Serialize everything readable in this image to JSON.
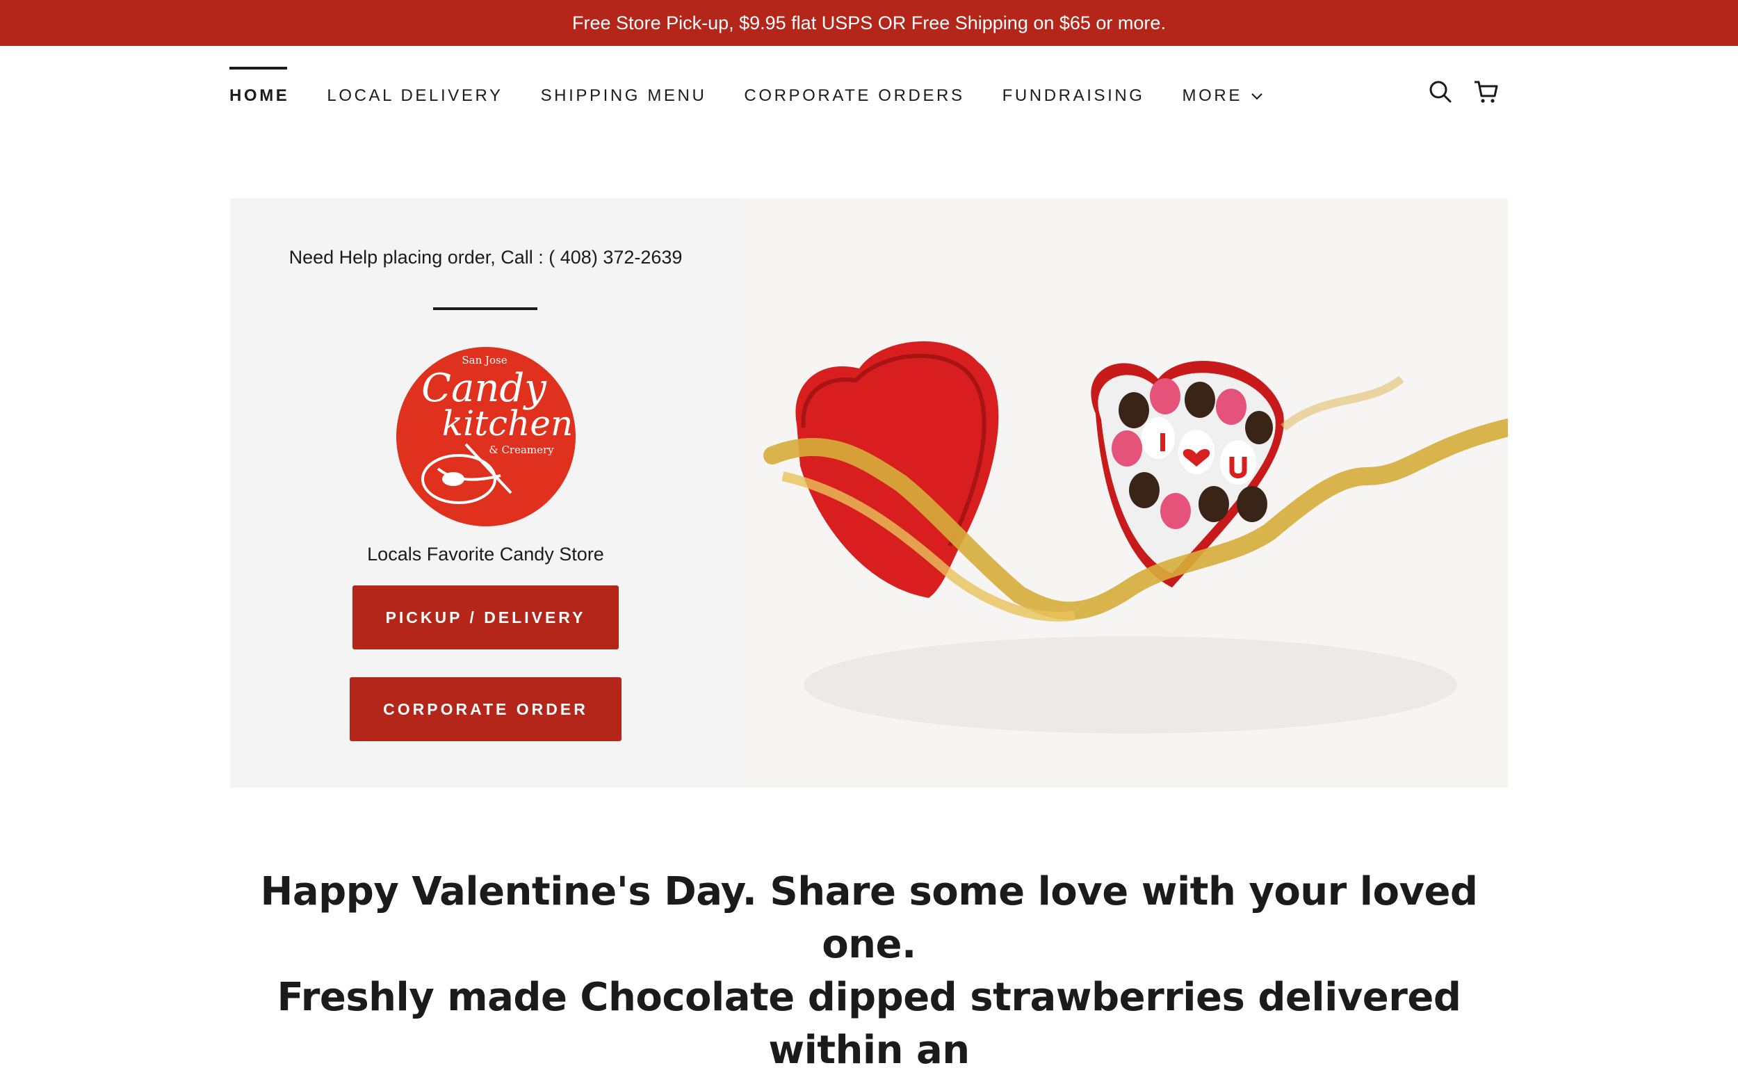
{
  "announcement": {
    "text": "Free Store Pick-up, $9.95 flat USPS OR Free Shipping on $65 or more."
  },
  "nav": {
    "items": [
      {
        "label": "HOME",
        "active": true
      },
      {
        "label": "LOCAL DELIVERY"
      },
      {
        "label": "SHIPPING MENU"
      },
      {
        "label": "CORPORATE ORDERS"
      },
      {
        "label": "FUNDRAISING"
      },
      {
        "label": "MORE",
        "has_dropdown": true
      }
    ],
    "icons": [
      "search-icon",
      "cart-icon"
    ]
  },
  "hero": {
    "help_text": "Need Help placing order, Call : ( 408) 372-2639",
    "logo": {
      "line1": "San Jose",
      "line2": "Candy",
      "line3": "kitchen",
      "line4": "& Creamery"
    },
    "tagline": "Locals Favorite Candy Store",
    "buttons": [
      {
        "label": "PICKUP / DELIVERY"
      },
      {
        "label": "CORPORATE ORDER"
      }
    ]
  },
  "headline": {
    "line1": "Happy Valentine's Day. Share some love with your loved one.",
    "line2": "Freshly made Chocolate dipped strawberries delivered within an"
  },
  "colors": {
    "brand_red": "#b4261a",
    "panel_gray": "#f4f4f4",
    "text": "#1b1b1b"
  }
}
